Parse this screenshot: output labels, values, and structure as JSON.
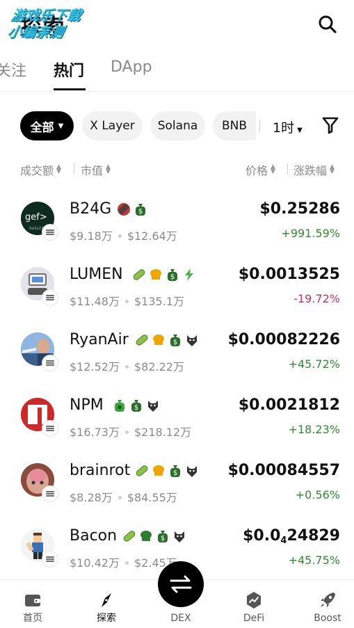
{
  "header": {
    "title": "探索",
    "watermark_line1": "游戏乐下载",
    "watermark_line2": "小编亲测"
  },
  "tabs": [
    {
      "label": "关注"
    },
    {
      "label": "热门"
    },
    {
      "label": "DApp"
    }
  ],
  "chips": [
    {
      "label": "全部"
    },
    {
      "label": "X Layer"
    },
    {
      "label": "Solana"
    },
    {
      "label": "BNB"
    }
  ],
  "timeframe": "1时",
  "sort": {
    "volume": "成交额",
    "mcap": "市值",
    "price": "价格",
    "change": "涨跌幅"
  },
  "tokens": [
    {
      "name": "B24G",
      "volume": "$9.18万",
      "mcap": "$12.64万",
      "price": "$0.25286",
      "change": "+991.59%",
      "dir": "up",
      "tags": [
        "striped-coin-icon",
        "money-bag-icon"
      ]
    },
    {
      "name": "LUMEN",
      "volume": "$11.48万",
      "mcap": "$135.1万",
      "price": "$0.0013525",
      "change": "-19.72%",
      "dir": "down",
      "tags": [
        "pill-icon",
        "chef-hat-icon",
        "money-bag-icon",
        "lightning-icon"
      ]
    },
    {
      "name": "RyanAir",
      "volume": "$12.52万",
      "mcap": "$82.22万",
      "price": "$0.00082226",
      "change": "+45.72%",
      "dir": "up",
      "tags": [
        "pill-icon",
        "chef-hat-icon",
        "money-bag-icon",
        "wolf-icon"
      ]
    },
    {
      "name": "NPM",
      "volume": "$16.73万",
      "mcap": "$218.12万",
      "price": "$0.0021812",
      "change": "+18.23%",
      "dir": "up",
      "tags": [
        "green-bag-icon",
        "money-bag-icon",
        "wolf-icon"
      ]
    },
    {
      "name": "brainrot",
      "volume": "$8.28万",
      "mcap": "$84.55万",
      "price": "$0.00084557",
      "change": "+0.56%",
      "dir": "up",
      "tags": [
        "pill-icon",
        "chef-hat-icon",
        "money-bag-icon",
        "wolf-icon"
      ]
    },
    {
      "name": "Bacon",
      "volume": "$10.42万",
      "mcap": "$2.45万",
      "price_main": "$0.0",
      "price_sub": "4",
      "price_rest": "24829",
      "change": "+45.75%",
      "dir": "up",
      "tags": [
        "pill-icon",
        "green-hat-icon",
        "money-bag-icon",
        "wolf-icon"
      ]
    }
  ],
  "avatars": {
    "t0_text": "gef>",
    "t0_sub": "bata24"
  },
  "nav": [
    {
      "label": "首页",
      "icon": "wallet-icon"
    },
    {
      "label": "探索",
      "icon": "compass-icon"
    },
    {
      "label": "DEX",
      "icon": "swap-icon"
    },
    {
      "label": "DeFi",
      "icon": "defi-icon"
    },
    {
      "label": "Boost",
      "icon": "rocket-icon"
    }
  ],
  "colors": {
    "up": "#2e8b2e",
    "down": "#c3305a",
    "chip_active_bg": "#000000",
    "chip_bg": "#f2f2f2"
  }
}
